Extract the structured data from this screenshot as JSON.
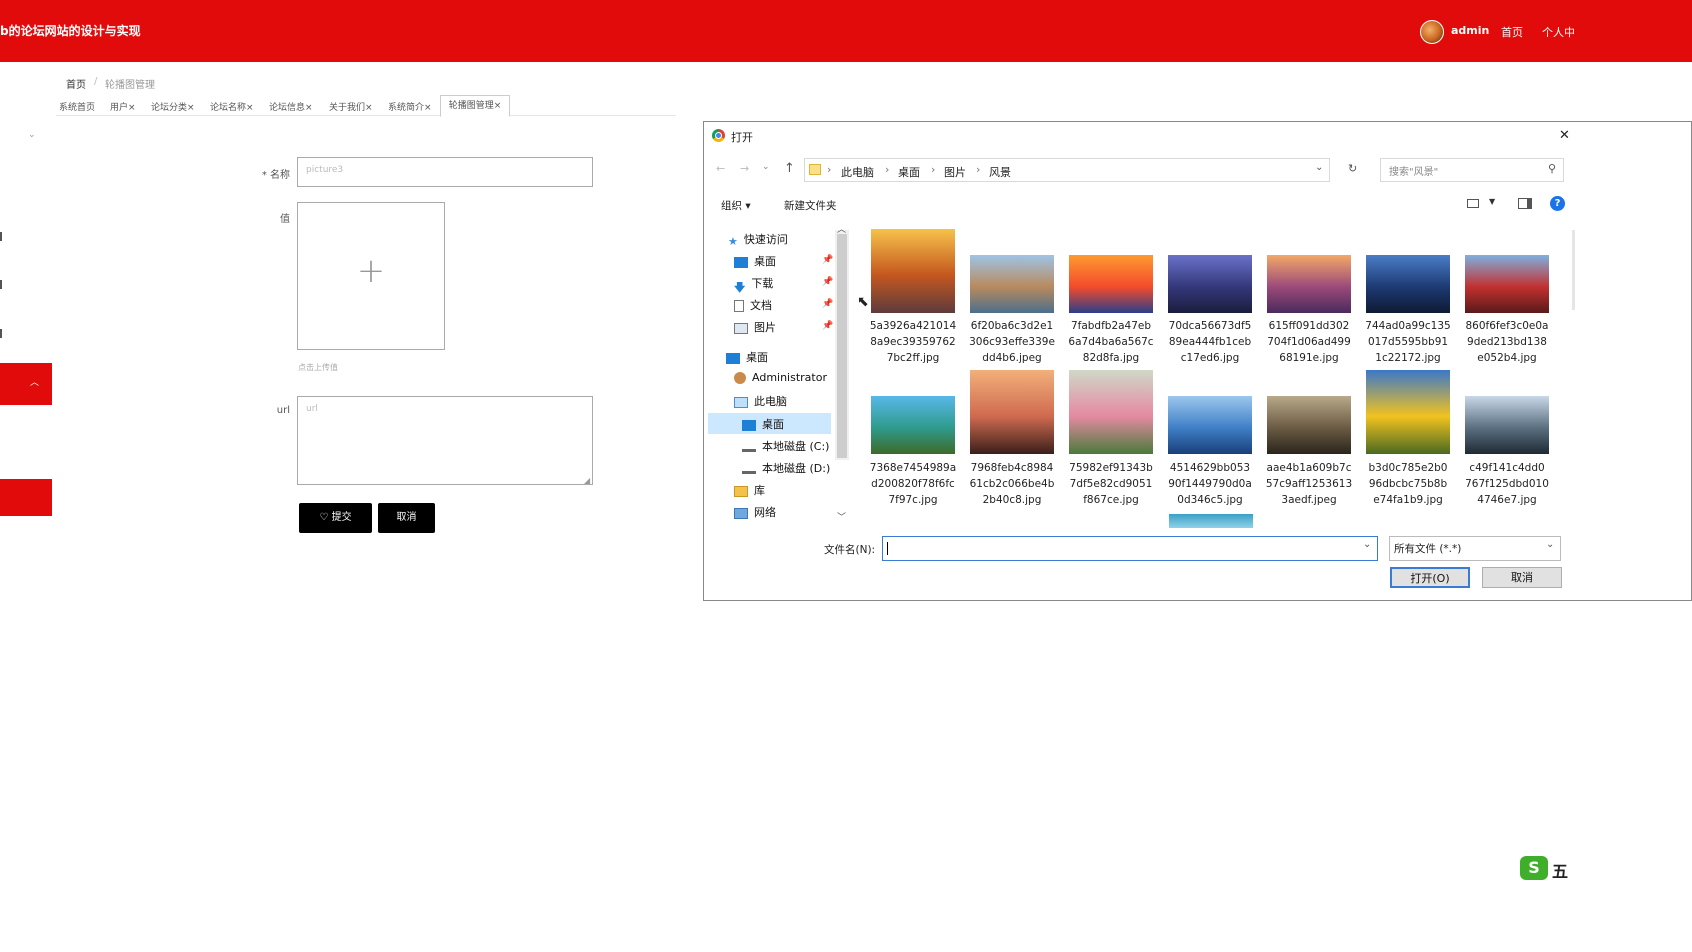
{
  "header": {
    "title": "b的论坛网站的设计与实现",
    "user": "admin",
    "home_link": "首页",
    "profile_link": "个人中"
  },
  "breadcrumb": {
    "home": "首页",
    "sep": "/",
    "current": "轮播图管理"
  },
  "tabs": [
    {
      "label": "系统首页"
    },
    {
      "label": "用户×"
    },
    {
      "label": "论坛分类×"
    },
    {
      "label": "论坛名称×"
    },
    {
      "label": "论坛信息×"
    },
    {
      "label": "关于我们×"
    },
    {
      "label": "系统简介×"
    },
    {
      "label": "轮播图管理×"
    }
  ],
  "form": {
    "name_label": "* 名称",
    "name_value": "picture3",
    "value_label": "值",
    "upload_plus": "+",
    "upload_hint": "点击上传值",
    "url_label": "url",
    "url_placeholder": "url",
    "submit_label": "♡ 提交",
    "cancel_label": "取消"
  },
  "dialog": {
    "title": "打开",
    "close": "✕",
    "address": [
      "此电脑",
      "桌面",
      "图片",
      "风景"
    ],
    "search_placeholder": "搜索\"风景\"",
    "organize": "组织 ▾",
    "new_folder": "新建文件夹",
    "nav": {
      "quick_access": "快速访问",
      "desktop": "桌面",
      "downloads": "下载",
      "documents": "文档",
      "pictures": "图片",
      "desktop2": "桌面",
      "administrator": "Administrator",
      "this_pc": "此电脑",
      "pc_desktop": "桌面",
      "drive_c": "本地磁盘 (C:)",
      "drive_d": "本地磁盘 (D:)",
      "libraries": "库",
      "network": "网络"
    },
    "files": [
      {
        "name": "5a3926a4210148a9ec393597627bc2ff.jpg",
        "l1": "5a3926a421014",
        "l2": "8a9ec39359762",
        "l3": "7bc2ff.jpg",
        "colors": [
          "#f6c24a",
          "#c4571f",
          "#5d3b3c"
        ]
      },
      {
        "name": "6f20ba6c3d2e1306c93effe339edd4b6.jpeg",
        "l1": "6f20ba6c3d2e1",
        "l2": "306c93effe339e",
        "l3": "dd4b6.jpeg",
        "colors": [
          "#9fc4e6",
          "#b88a5e",
          "#4b6f8c"
        ]
      },
      {
        "name": "7fabdfb2a47eb6a7d4ba6a567c82d8fa.jpg",
        "l1": "7fabdfb2a47eb",
        "l2": "6a7d4ba6a567c",
        "l3": "82d8fa.jpg",
        "colors": [
          "#ff9a30",
          "#f34b2b",
          "#2a3e8a"
        ]
      },
      {
        "name": "70dca56673df589ea444fb1cebc17ed6.jpg",
        "l1": "70dca56673df5",
        "l2": "89ea444fb1ceb",
        "l3": "c17ed6.jpg",
        "colors": [
          "#6a72c9",
          "#34387a",
          "#1b1d3c"
        ]
      },
      {
        "name": "615ff091dd302704f1d06ad49968191e.jpg",
        "l1": "615ff091dd302",
        "l2": "704f1d06ad499",
        "l3": "68191e.jpg",
        "colors": [
          "#f3a868",
          "#9b4a7a",
          "#4a2a5c"
        ]
      },
      {
        "name": "744ad0a99c135017d5595bb911c22172.jpg",
        "l1": "744ad0a99c135",
        "l2": "017d5595bb91",
        "l3": "1c22172.jpg",
        "colors": [
          "#4b7dc7",
          "#1d3a73",
          "#0f1a33"
        ]
      },
      {
        "name": "860f6fef3c0e09ded213bd138e052b4.jpg",
        "l1": "860f6fef3c0e0a",
        "l2": "9ded213bd138",
        "l3": "e052b4.jpg",
        "colors": [
          "#7fb0e0",
          "#c23030",
          "#5a1a1a"
        ]
      },
      {
        "name": "7368e7454989ad200820f78f6fc7f97c.jpg",
        "l1": "7368e7454989a",
        "l2": "d200820f78f6fc",
        "l3": "7f97c.jpg",
        "colors": [
          "#58b8e8",
          "#2f9b8c",
          "#3d6a2a"
        ]
      },
      {
        "name": "7968feb4c898461cb2c066be4b2b40c8.jpg",
        "l1": "7968feb4c8984",
        "l2": "61cb2c066be4b",
        "l3": "2b40c8.jpg",
        "colors": [
          "#f2b07a",
          "#d06a50",
          "#3a1f1a"
        ]
      },
      {
        "name": "75982ef91343b7df5e82cd9051f867ce.jpg",
        "l1": "75982ef91343b",
        "l2": "7df5e82cd9051",
        "l3": "f867ce.jpg",
        "colors": [
          "#cfd8c8",
          "#e58aa2",
          "#4a7a3a"
        ]
      },
      {
        "name": "4514629bb05390f1449790d0a0d346c5.jpg",
        "l1": "4514629bb053",
        "l2": "90f1449790d0a",
        "l3": "0d346c5.jpg",
        "colors": [
          "#9cc7ee",
          "#3f7fc6",
          "#1a3f7a"
        ]
      },
      {
        "name": "aae4b1a609b7c57c9aff12536133aedf.jpeg",
        "l1": "aae4b1a609b7c",
        "l2": "57c9aff1253613",
        "l3": "3aedf.jpeg",
        "colors": [
          "#b9a98a",
          "#6a5b43",
          "#2a251c"
        ]
      },
      {
        "name": "b3d0c785e2b096dbcbc75b8be74fa1b9.jpg",
        "l1": "b3d0c785e2b0",
        "l2": "96dbcbc75b8b",
        "l3": "e74fa1b9.jpg",
        "colors": [
          "#3b78c8",
          "#f2c220",
          "#4a6a20"
        ]
      },
      {
        "name": "c49f141c4dd0767f125dbd0104746e7.jpg",
        "l1": "c49f141c4dd0",
        "l2": "767f125dbd010",
        "l3": "4746e7.jpg",
        "colors": [
          "#c9d8e8",
          "#5a6f80",
          "#1f2a33"
        ]
      }
    ],
    "filename_label": "文件名(N):",
    "filename_value": "",
    "filetype": "所有文件 (*.*)",
    "open_button": "打开(O)",
    "cancel_button": "取消"
  },
  "watermark": {
    "glyph": "S",
    "text": "五"
  },
  "colors": {
    "brand_red": "#e20b0b",
    "focus_blue": "#3a7bd5"
  }
}
